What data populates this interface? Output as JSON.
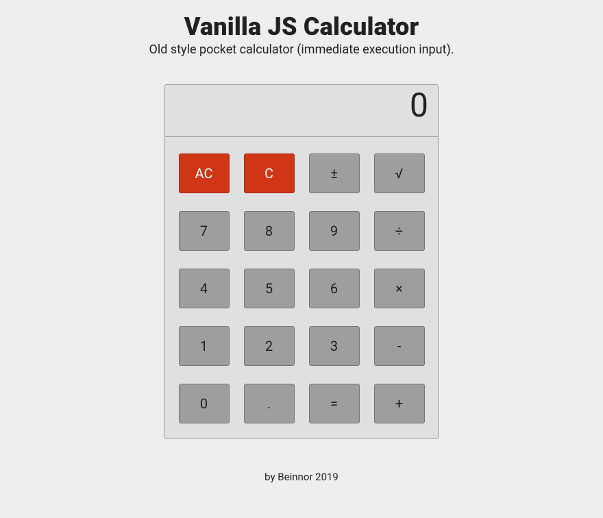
{
  "header": {
    "title": "Vanilla JS Calculator",
    "subtitle": "Old style pocket calculator (immediate execution input)."
  },
  "display": {
    "value": "0"
  },
  "keys": {
    "ac": "AC",
    "c": "C",
    "pm": "±",
    "sqrt": "√",
    "k7": "7",
    "k8": "8",
    "k9": "9",
    "div": "÷",
    "k4": "4",
    "k5": "5",
    "k6": "6",
    "mul": "×",
    "k1": "1",
    "k2": "2",
    "k3": "3",
    "sub": "-",
    "k0": "0",
    "dot": ".",
    "eq": "=",
    "add": "+"
  },
  "footer": "by Beinnor 2019"
}
